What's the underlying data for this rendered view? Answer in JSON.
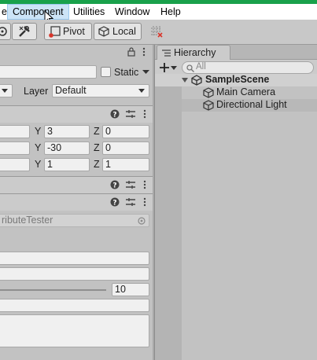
{
  "menubar": {
    "items": [
      "Component",
      "Utilities",
      "Window",
      "Help"
    ],
    "partial_left": "e"
  },
  "toolbar": {
    "pivot_label": "Pivot",
    "local_label": "Local"
  },
  "inspector": {
    "static_label": "Static",
    "layer_label": "Layer",
    "layer_value": "Default",
    "transform": {
      "rows": [
        {
          "y": "3",
          "z": "0"
        },
        {
          "y": "-30",
          "z": "0"
        },
        {
          "y": "1",
          "z": "1"
        }
      ],
      "y_label": "Y",
      "z_label": "Z"
    },
    "script_field": "ributeTester",
    "slider_value": "10"
  },
  "hierarchy": {
    "tab_label": "Hierarchy",
    "search_placeholder": "All",
    "scene": "SampleScene",
    "items": [
      "Main Camera",
      "Directional Light"
    ]
  },
  "colors": {
    "top_stripe": "#19a14b",
    "menu_highlight": "#cce4f7",
    "selected_row": "#b8b8b8"
  }
}
